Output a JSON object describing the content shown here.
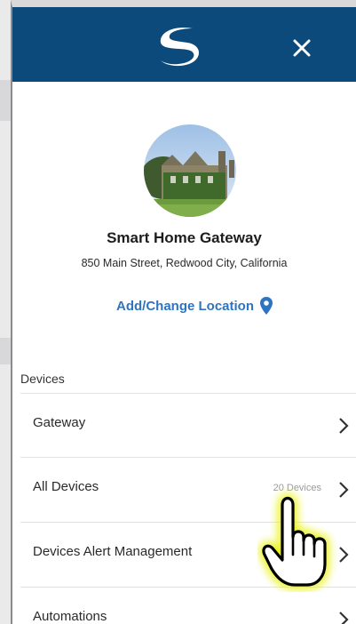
{
  "header": {
    "close_label": "✕"
  },
  "profile": {
    "title": "Smart Home Gateway",
    "address": "850 Main Street, Redwood City, California",
    "location_link": "Add/Change Location"
  },
  "devices": {
    "section_label": "Devices",
    "items": [
      {
        "label": "Gateway",
        "count": ""
      },
      {
        "label": "All Devices",
        "count": "20 Devices"
      },
      {
        "label": "Devices Alert Management",
        "count": ""
      },
      {
        "label": "Automations",
        "count": ""
      }
    ]
  },
  "colors": {
    "header_bg": "#0b4a7a",
    "accent_link": "#2f74c0",
    "pointer_glow": "#e9f20a"
  }
}
